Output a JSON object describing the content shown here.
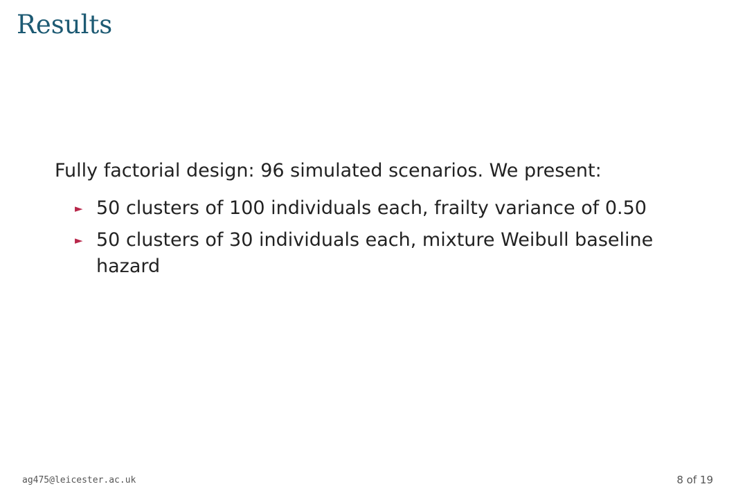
{
  "slide": {
    "title": "Results",
    "intro": "Fully factorial design: 96 simulated scenarios. We present:",
    "bullets": [
      {
        "marker": "►",
        "text": "50 clusters of 100 individuals each, frailty variance of 0.50"
      },
      {
        "marker": "►",
        "text": "50 clusters of 30 individuals each, mixture Weibull baseline hazard"
      }
    ]
  },
  "footer": {
    "email": "ag475@leicester.ac.uk",
    "page_number": "8 of 19"
  },
  "colors": {
    "title": "#1d5a73",
    "bullet_marker": "#b8274a",
    "text": "#222222",
    "footer": "#555555"
  }
}
